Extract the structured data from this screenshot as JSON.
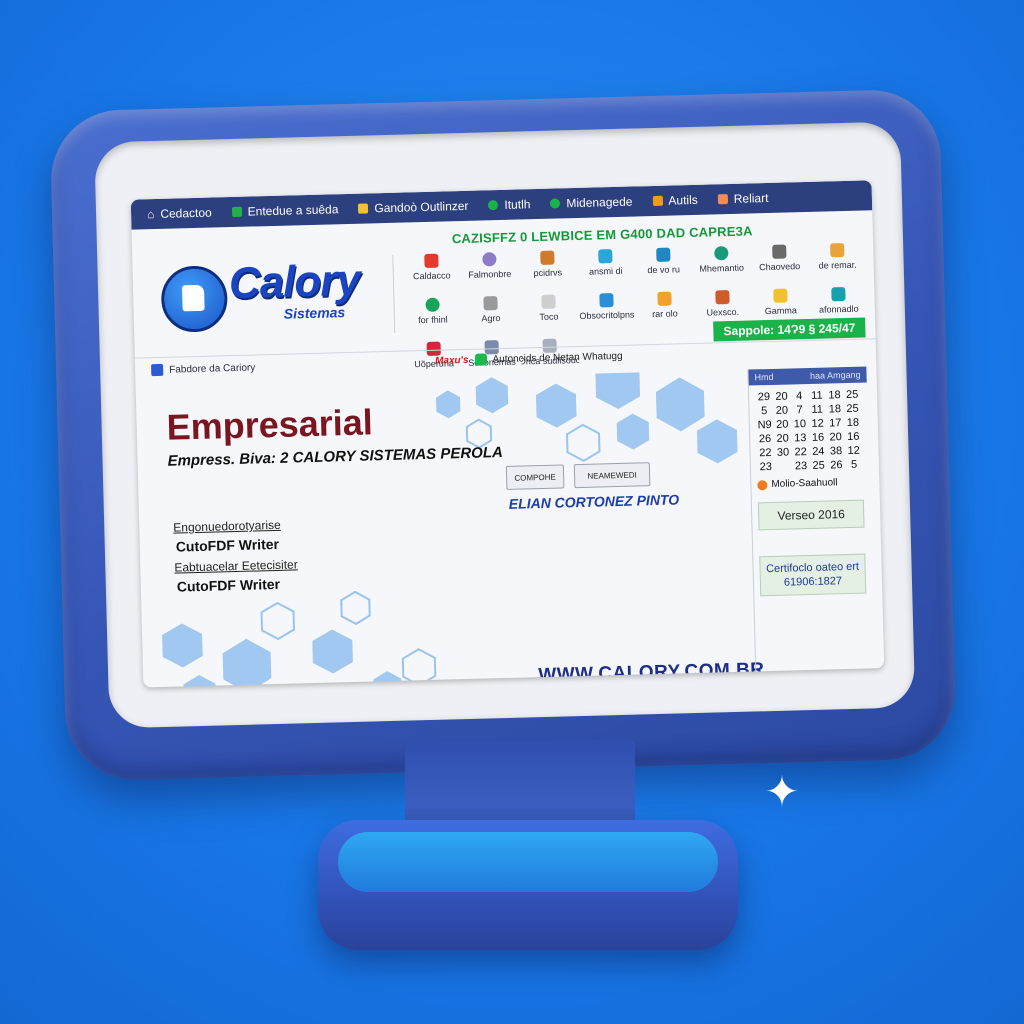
{
  "topnav": {
    "items": [
      {
        "label": "Cedactoo",
        "color": "#ffffff"
      },
      {
        "label": "Entedue a suêda",
        "color": "#22b04a"
      },
      {
        "label": "Gandoò Outlinzer",
        "color": "#f2c12e"
      },
      {
        "label": "Itutlh",
        "color": "#1ab34a"
      },
      {
        "label": "Midenagede",
        "color": "#1ab34a"
      },
      {
        "label": "Autils",
        "color": "#f29a1a"
      },
      {
        "label": "Reliart",
        "color": "#f28a5a"
      }
    ]
  },
  "ticker": "CAZISFFZ 0 LEWBICE EM G400 DAD CAPRE3A",
  "logo": {
    "name": "Calory",
    "sub": "Sistemas"
  },
  "iconbar": [
    {
      "label": "Caldacco",
      "color": "#e23b2e"
    },
    {
      "label": "Falmonbre",
      "color": "#8d7cc9"
    },
    {
      "label": "pcidrvs",
      "color": "#d07a2c"
    },
    {
      "label": "ansmi di",
      "color": "#2aa7d8"
    },
    {
      "label": "de vo ru",
      "color": "#1f88c0"
    },
    {
      "label": "Mhemantio",
      "color": "#1a9a7a"
    },
    {
      "label": "Chaovedo",
      "color": "#6a6a6a"
    },
    {
      "label": "de remar.",
      "color": "#e8a33b"
    },
    {
      "label": "for fhinl",
      "color": "#1aa35a"
    },
    {
      "label": "Agro",
      "color": "#9a9a9a"
    },
    {
      "label": "Toco",
      "color": "#cfcfcf"
    },
    {
      "label": "Obsocritolpns",
      "color": "#2a8fd6"
    },
    {
      "label": "rar olo",
      "color": "#f2a12e"
    },
    {
      "label": "Uexsco.",
      "color": "#d05a2a"
    },
    {
      "label": "Gamma",
      "color": "#f2c12e"
    },
    {
      "label": "afonnadlo",
      "color": "#1a9fb0"
    },
    {
      "label": "Uõperuna",
      "color": "#d02a3a"
    },
    {
      "label": "Scdonemas",
      "color": "#7a8aa8"
    },
    {
      "label": "Drica sudlisouo",
      "color": "#a8b0c0"
    }
  ],
  "subbar": {
    "facebook": "Fabdore da Cariory",
    "news_tag": "Maxu's",
    "news_text": "Autoncids de Netan Whatugg",
    "support": "Sappole: 14Ɂ9 § 245/47"
  },
  "main": {
    "title": "Empresarial",
    "subtitle": "Empress. Biva: 2 CALORY SISTEMAS PEROLA",
    "btn1": "COMPOHE",
    "btn2": "NEAMEWEDI",
    "person": "ELIAN CORTONEZ PINTO",
    "label1": "Engonuedorotyarise",
    "value1": "CutoFDF Writer",
    "label2": "Eabtuacelar Eetecisiter",
    "value2": "CutoFDF Writer",
    "url": "WWW.CALORY.COM.BR"
  },
  "calendar": {
    "head_left": "Hmd",
    "head_right": "haa Amgang",
    "rows": [
      [
        "",
        "",
        "",
        "",
        "",
        ""
      ],
      [
        "29",
        "20",
        "4",
        "11",
        "18",
        "25"
      ],
      [
        "5",
        "20",
        "7",
        "11",
        "18",
        "25"
      ],
      [
        "N9",
        "20",
        "10",
        "12",
        "17",
        "18"
      ],
      [
        "26",
        "20",
        "13",
        "16",
        "20",
        "16"
      ],
      [
        "22",
        "30",
        "22",
        "24",
        "38",
        "12"
      ],
      [
        "23",
        "",
        "23",
        "25",
        "26",
        "5"
      ]
    ],
    "holiday": "Molio-Saahuoll"
  },
  "version": "Verseo 2016",
  "cert": {
    "line1": "Certifoclo oateo ert",
    "line2": "61906:1827"
  }
}
